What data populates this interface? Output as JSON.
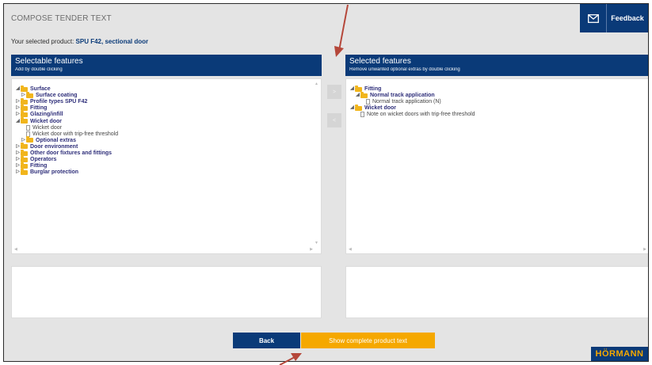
{
  "header": {
    "title": "COMPOSE TENDER TEXT",
    "feedback_label": "Feedback"
  },
  "product": {
    "label": "Your selected product:",
    "name": "SPU F42, sectional door"
  },
  "left_panel": {
    "title": "Selectable features",
    "subtitle": "Add by double clicking",
    "items": [
      {
        "label": "Surface",
        "level": 0,
        "type": "folder",
        "state": "open"
      },
      {
        "label": "Surface coating",
        "level": 1,
        "type": "folder",
        "state": "closed"
      },
      {
        "label": "Profile types SPU F42",
        "level": 0,
        "type": "folder",
        "state": "closed"
      },
      {
        "label": "Fitting",
        "level": 0,
        "type": "folder",
        "state": "closed"
      },
      {
        "label": "Glazing/infill",
        "level": 0,
        "type": "folder",
        "state": "closed"
      },
      {
        "label": "Wicket door",
        "level": 0,
        "type": "folder",
        "state": "open"
      },
      {
        "label": "Wicket door",
        "level": 1,
        "type": "leaf"
      },
      {
        "label": "Wicket door with trip-free threshold",
        "level": 1,
        "type": "leaf"
      },
      {
        "label": "Optional extras",
        "level": 1,
        "type": "folder",
        "state": "closed"
      },
      {
        "label": "Door environment",
        "level": 0,
        "type": "folder",
        "state": "closed"
      },
      {
        "label": "Other door fixtures and fittings",
        "level": 0,
        "type": "folder",
        "state": "closed"
      },
      {
        "label": "Operators",
        "level": 0,
        "type": "folder",
        "state": "closed"
      },
      {
        "label": "Fitting",
        "level": 0,
        "type": "folder",
        "state": "closed"
      },
      {
        "label": "Burglar protection",
        "level": 0,
        "type": "folder",
        "state": "closed"
      }
    ]
  },
  "right_panel": {
    "title": "Selected features",
    "subtitle": "Remove unwanted optional extras by double clicking",
    "items": [
      {
        "label": "Fitting",
        "level": 0,
        "type": "folder",
        "state": "open"
      },
      {
        "label": "Normal track application",
        "level": 1,
        "type": "folder",
        "state": "open"
      },
      {
        "label": "Normal track application (N)",
        "level": 2,
        "type": "leaf"
      },
      {
        "label": "Wicket door",
        "level": 0,
        "type": "folder",
        "state": "open"
      },
      {
        "label": "Note on wicket doors with trip-free threshold",
        "level": 1,
        "type": "leaf"
      }
    ]
  },
  "move_buttons": {
    "add": ">",
    "remove": "<"
  },
  "footer": {
    "back_label": "Back",
    "show_label": "Show complete product text",
    "logo": "HÖRMANN"
  },
  "colors": {
    "brand_blue": "#0a3a78",
    "accent_orange": "#f5a800",
    "folder_yellow": "#f1b51c",
    "annotation_red": "#b5473a"
  }
}
